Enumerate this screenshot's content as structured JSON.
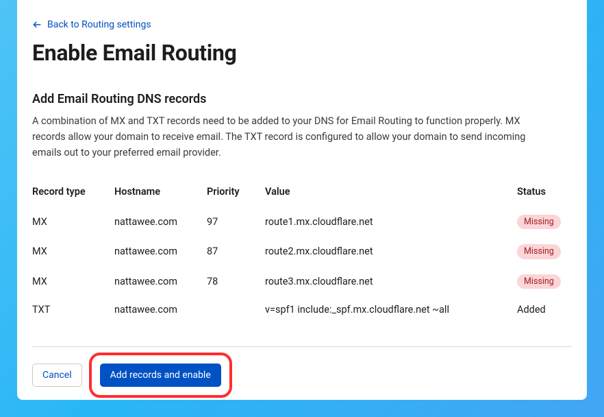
{
  "back_link": {
    "label": "Back to Routing settings"
  },
  "title": "Enable Email Routing",
  "section_heading": "Add Email Routing DNS records",
  "description": "A combination of MX and TXT records need to be added to your DNS for Email Routing to function properly. MX records allow your domain to receive email. The TXT record is configured to allow your domain to send incoming emails out to your preferred email provider.",
  "table": {
    "headers": {
      "record_type": "Record type",
      "hostname": "Hostname",
      "priority": "Priority",
      "value": "Value",
      "status": "Status"
    },
    "rows": [
      {
        "type": "MX",
        "hostname": "nattawee.com",
        "priority": "97",
        "value": "route1.mx.cloudflare.net",
        "status": "Missing",
        "status_kind": "missing"
      },
      {
        "type": "MX",
        "hostname": "nattawee.com",
        "priority": "87",
        "value": "route2.mx.cloudflare.net",
        "status": "Missing",
        "status_kind": "missing"
      },
      {
        "type": "MX",
        "hostname": "nattawee.com",
        "priority": "78",
        "value": "route3.mx.cloudflare.net",
        "status": "Missing",
        "status_kind": "missing"
      },
      {
        "type": "TXT",
        "hostname": "nattawee.com",
        "priority": "",
        "value": "v=spf1 include:_spf.mx.cloudflare.net ~all",
        "status": "Added",
        "status_kind": "added"
      }
    ]
  },
  "buttons": {
    "cancel": "Cancel",
    "primary": "Add records and enable"
  },
  "annotation": {
    "highlight_primary": true
  }
}
